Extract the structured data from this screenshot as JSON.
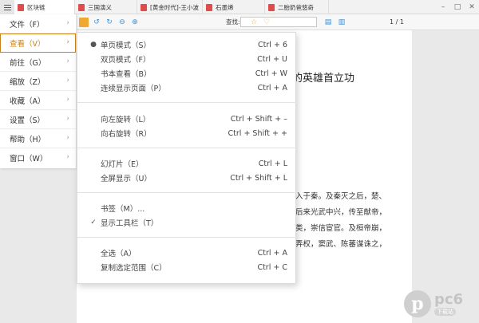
{
  "tabs": [
    {
      "label": "区块链",
      "active": true
    },
    {
      "label": "三国演义",
      "active": false
    },
    {
      "label": "[黄金时代]-王小波",
      "active": false
    },
    {
      "label": "石墨烯",
      "active": false
    },
    {
      "label": "二胎奶爸悠奇",
      "active": false
    }
  ],
  "toolbar": {
    "search_label": "查找:",
    "search_value": "",
    "page_indicator": "1 / 1",
    "icons": [
      "select-tool-icon",
      "rotate-left-icon",
      "rotate-right-icon",
      "zoom-out-icon",
      "zoom-in-icon",
      "single-page-icon",
      "double-page-icon",
      "bookmark-star-icon",
      "favorite-heart-icon"
    ]
  },
  "side_menu": [
    {
      "label": "文件（F）",
      "active": false
    },
    {
      "label": "查看（V）",
      "active": true
    },
    {
      "label": "前往（G）",
      "active": false
    },
    {
      "label": "缩放（Z）",
      "active": false
    },
    {
      "label": "收藏（A）",
      "active": false
    },
    {
      "label": "设置（S）",
      "active": false
    },
    {
      "label": "帮助（H）",
      "active": false
    },
    {
      "label": "窗口（W）",
      "active": false
    }
  ],
  "submenu": {
    "groups": [
      [
        {
          "label": "单页模式（S）",
          "shortcut": "Ctrl + 6",
          "mark": "●"
        },
        {
          "label": "双页模式（F）",
          "shortcut": "Ctrl + U",
          "mark": ""
        },
        {
          "label": "书本查看（B）",
          "shortcut": "Ctrl + W",
          "mark": ""
        },
        {
          "label": "连续显示页面（P）",
          "shortcut": "Ctrl + A",
          "mark": ""
        }
      ],
      [
        {
          "label": "向左旋转（L）",
          "shortcut": "Ctrl + Shift + –",
          "mark": ""
        },
        {
          "label": "向右旋转（R）",
          "shortcut": "Ctrl + Shift + +",
          "mark": ""
        }
      ],
      [
        {
          "label": "幻灯片（E）",
          "shortcut": "Ctrl + L",
          "mark": ""
        },
        {
          "label": "全屏显示（U）",
          "shortcut": "Ctrl + Shift + L",
          "mark": ""
        }
      ],
      [
        {
          "label": "书签（M）...",
          "shortcut": "",
          "mark": ""
        },
        {
          "label": "显示工具栏（T）",
          "shortcut": "",
          "mark": "✓"
        }
      ],
      [
        {
          "label": "全选（A）",
          "shortcut": "Ctrl + A",
          "mark": ""
        },
        {
          "label": "复制选定范围（C）",
          "shortcut": "Ctrl + C",
          "mark": ""
        }
      ]
    ]
  },
  "document": {
    "title_fragment": "的英雄首立功",
    "lines": [
      "入于秦。及秦灭之后，楚、",
      "后来光武中兴，传至献帝，",
      "类，崇信宦官。及桓帝崩，",
      "弄权，窦武、陈蕃谋诛之，"
    ]
  },
  "watermark": {
    "logo": "pc6",
    "tag": "下载站"
  },
  "colors": {
    "accent": "#c8831a",
    "pdf_icon": "#e04b4b"
  }
}
